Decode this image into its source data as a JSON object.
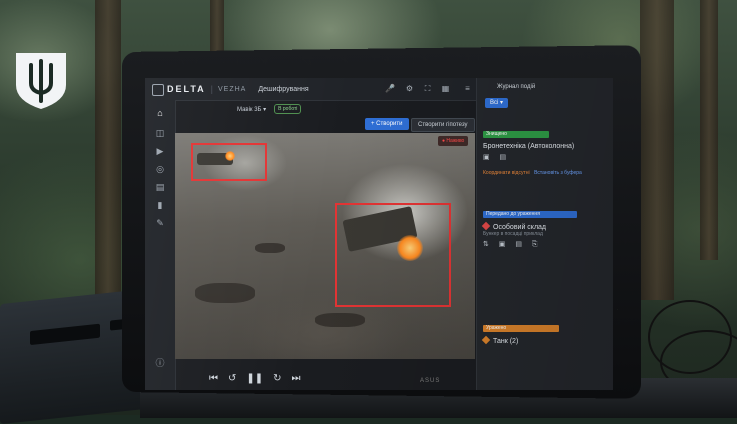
{
  "app": {
    "logo": "DELTA",
    "module": "VEZHA",
    "mode": "Дешифрування"
  },
  "toolbar": {
    "map_label": "Мавік 3Б ▾",
    "status_tag": "В роботі",
    "create_button": "+ Створити",
    "secondary_button": "Створити гіпотезу"
  },
  "video": {
    "rec_label": "● Наживо"
  },
  "panel": {
    "title": "Журнал подій",
    "filter": "Всі ▾",
    "events": [
      {
        "chip": "Знищено",
        "chip_color": "green",
        "title": "Бронетехніка (Автоколонна)",
        "warn": "Координати відсутні",
        "link": "Встановіть з буфера"
      },
      {
        "chip": "Передано до ураження",
        "chip_color": "blue",
        "title": "Особовий склад",
        "sub": "Бункер в посадці приклад"
      },
      {
        "chip": "Уражено",
        "chip_color": "orange",
        "title": "Танк (2)"
      }
    ]
  },
  "laptop_brand": "ASUS"
}
